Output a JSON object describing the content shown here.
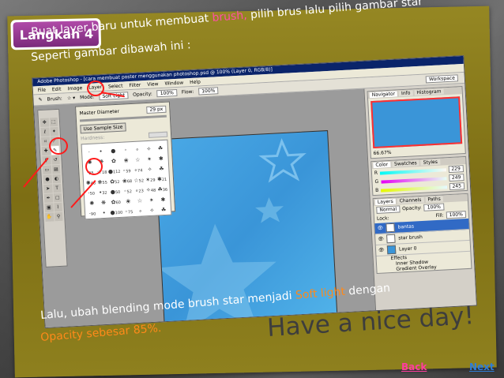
{
  "badge": {
    "label": "Langkah 4"
  },
  "instructions": {
    "line1_pre": "Buat layer baru untuk membuat ",
    "line1_highlight": "brush,",
    "line1_post": " pilih brus lalu pilih gambar star",
    "line2": "Seperti gambar dibawah ini :",
    "bottom_line1_pre": "Lalu, ubah blending mode brush star  menjadi ",
    "bottom_line1_highlight": "Soft light",
    "bottom_line1_post": "  dengan",
    "bottom_line2": "Opacity sebesar 85%."
  },
  "photoshop": {
    "title": "Adobe Photoshop - [cara membuat poster menggunakan photoshop.psd @ 100% (Layer 0, RGB/8)]",
    "menu": [
      "File",
      "Edit",
      "Image",
      "Layer",
      "Select",
      "Filter",
      "View",
      "Window",
      "Help"
    ],
    "options": {
      "brush_label": "Brush:",
      "mode_label": "Mode:",
      "mode_value": "Soft Light",
      "opacity_label": "Opacity:",
      "opacity_value": "100%",
      "flow_label": "Flow:",
      "flow_value": "100%",
      "workspace_label": "Workspace"
    },
    "brush_panel": {
      "master_diameter_label": "Master Diameter",
      "master_diameter_value": "29 px",
      "use_sample_size": "Use Sample Size",
      "hardness_label": "Hardness:",
      "sizes": [
        "",
        "",
        "",
        "",
        "",
        "",
        "",
        "",
        "",
        "",
        "",
        "",
        "",
        "",
        "25",
        "18",
        "112",
        "59",
        "74",
        "",
        "",
        "46",
        "55",
        "52",
        "68",
        "52",
        "29",
        "21",
        "50",
        "32",
        "50",
        "52",
        "23",
        "48",
        "36",
        "",
        "",
        "60",
        "",
        "",
        "",
        "",
        "90",
        "",
        "100",
        "75",
        "",
        "",
        ""
      ]
    },
    "navigator": {
      "tabs": [
        "Navigator",
        "Info",
        "Histogram"
      ],
      "zoom": "66.67%"
    },
    "color": {
      "tabs": [
        "Color",
        "Swatches",
        "Styles"
      ],
      "r_label": "R",
      "r_value": "229",
      "g_label": "G",
      "g_value": "249",
      "b_label": "B",
      "b_value": "245"
    },
    "layers": {
      "tabs": [
        "Layers",
        "Channels",
        "Paths"
      ],
      "blend_mode": "Normal",
      "opacity_label": "Opacity:",
      "opacity_value": "100%",
      "lock_label": "Lock:",
      "fill_label": "Fill:",
      "fill_value": "100%",
      "items": [
        "bantas",
        "star brush",
        "Layer 0"
      ],
      "effects_label": "Effects",
      "effect_items": [
        "Inner Shadow",
        "Gradient Overlay"
      ]
    }
  },
  "tagline": "Have a nice day!",
  "nav": {
    "back": "Back",
    "next": "Next"
  },
  "colors": {
    "slide": "#8e801e",
    "badge": "#8b3a8c",
    "highlight_pink": "#ff4fa8",
    "highlight_orange": "#ff8a1a",
    "canvas": "#3a95d8"
  }
}
